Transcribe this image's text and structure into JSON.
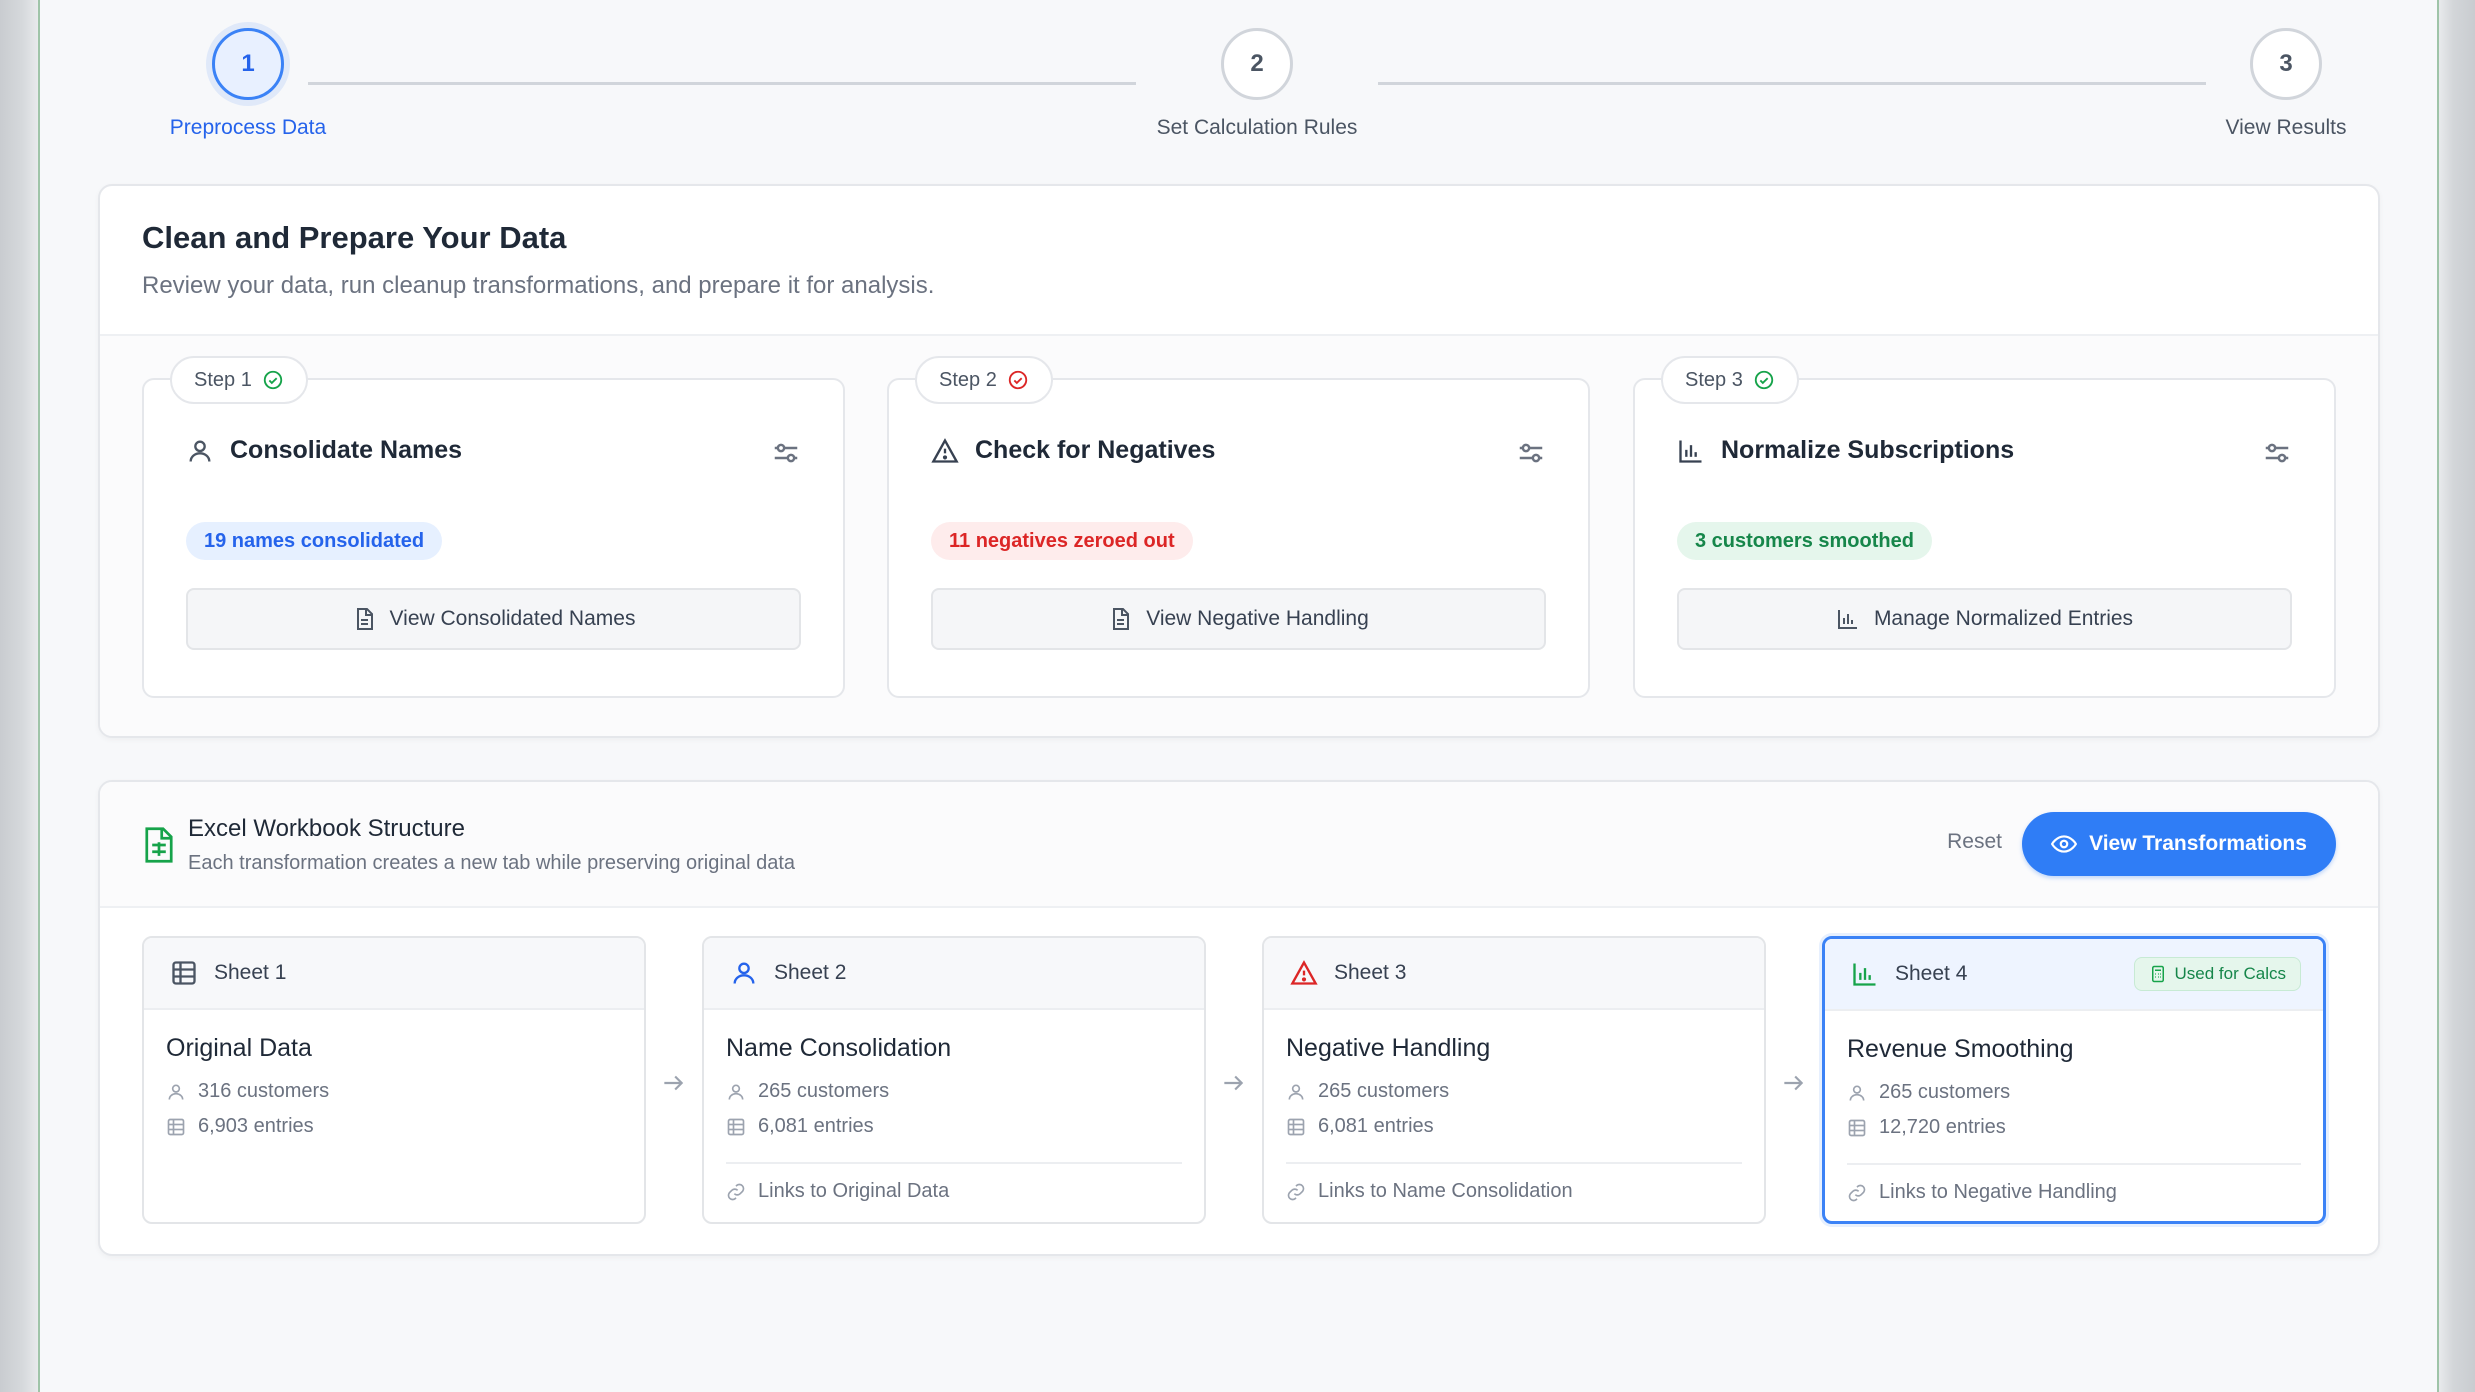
{
  "stepper": {
    "steps": [
      {
        "number": "1",
        "label": "Preprocess Data",
        "active": true
      },
      {
        "number": "2",
        "label": "Set Calculation Rules",
        "active": false
      },
      {
        "number": "3",
        "label": "View Results",
        "active": false
      }
    ]
  },
  "prepare": {
    "title": "Clean and Prepare Your Data",
    "subtitle": "Review your data, run cleanup transformations, and prepare it for analysis.",
    "tasks": [
      {
        "tag": "Step 1",
        "status": "complete",
        "status_icon": "check-circle-icon",
        "icon": "user-icon",
        "name": "Consolidate Names",
        "pill": "19 names consolidated",
        "pill_color": "blue",
        "button": "View Consolidated Names",
        "button_icon": "document-icon"
      },
      {
        "tag": "Step 2",
        "status": "error",
        "status_icon": "check-circle-icon",
        "icon": "warning-triangle-icon",
        "name": "Check for Negatives",
        "pill": "11 negatives zeroed out",
        "pill_color": "red",
        "button": "View Negative Handling",
        "button_icon": "document-icon"
      },
      {
        "tag": "Step 3",
        "status": "complete",
        "status_icon": "check-circle-icon",
        "icon": "bar-chart-icon",
        "name": "Normalize Subscriptions",
        "pill": "3 customers smoothed",
        "pill_color": "green",
        "button": "Manage Normalized Entries",
        "button_icon": "bar-chart-icon"
      }
    ]
  },
  "workbook": {
    "title": "Excel Workbook Structure",
    "subtitle": "Each transformation creates a new tab while preserving original data",
    "reset_label": "Reset",
    "view_label": "View Transformations",
    "sheets": [
      {
        "tab": "Sheet 1",
        "icon": "table-grid-icon",
        "title": "Original Data",
        "customers": "316 customers",
        "entries": "6,903 entries",
        "link": ""
      },
      {
        "tab": "Sheet 2",
        "icon": "user-icon",
        "title": "Name Consolidation",
        "customers": "265 customers",
        "entries": "6,081 entries",
        "link": "Links to Original Data"
      },
      {
        "tab": "Sheet 3",
        "icon": "warning-triangle-icon",
        "title": "Negative Handling",
        "customers": "265 customers",
        "entries": "6,081 entries",
        "link": "Links to Name Consolidation"
      },
      {
        "tab": "Sheet 4",
        "icon": "bar-chart-icon",
        "title": "Revenue Smoothing",
        "customers": "265 customers",
        "entries": "12,720 entries",
        "link": "Links to Negative Handling",
        "badge": "Used for Calcs",
        "selected": true
      }
    ]
  },
  "colors": {
    "accent": "#2f7df6",
    "success": "#16a34a",
    "danger": "#dc2626"
  }
}
